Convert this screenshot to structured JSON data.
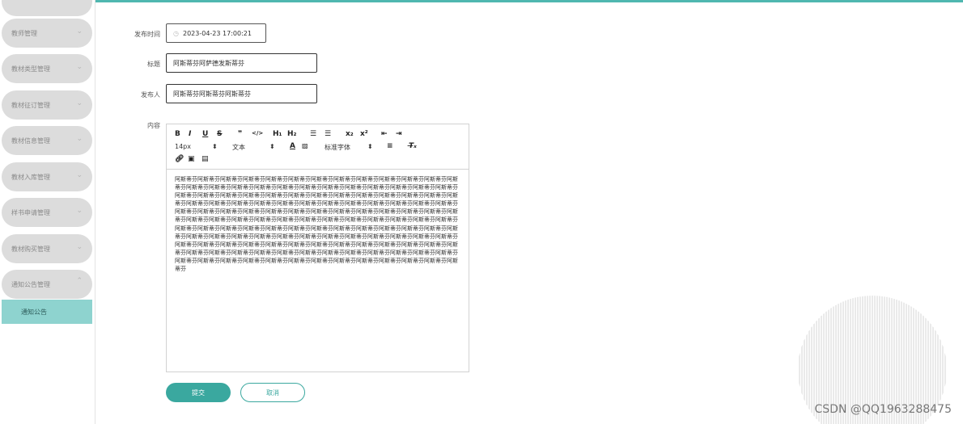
{
  "sidebar": {
    "items": [
      {
        "label": "教师管理"
      },
      {
        "label": "教材类型管理"
      },
      {
        "label": "教材征订管理"
      },
      {
        "label": "教材信息管理"
      },
      {
        "label": "教材入库管理"
      },
      {
        "label": "样书申请管理"
      },
      {
        "label": "教材购买管理"
      },
      {
        "label": "通知公告管理"
      }
    ],
    "active_sub": "通知公告"
  },
  "form": {
    "publish_time_label": "发布时间",
    "publish_time_value": "2023-04-23 17:00:21",
    "title_label": "标题",
    "title_value": "阿斯蒂芬阿萨德发斯蒂芬",
    "publisher_label": "发布人",
    "publisher_value": "阿斯蒂芬阿斯蒂芬阿斯蒂芬",
    "content_label": "内容"
  },
  "editor": {
    "font_size": "14px",
    "paragraph": "文本",
    "font_family": "标准字体",
    "content": "阿斯蒂芬阿斯蒂芬阿斯蒂芬阿斯蒂芬阿斯蒂芬阿斯蒂芬阿斯蒂芬阿斯蒂芬阿斯蒂芬阿斯蒂芬阿斯蒂芬阿斯蒂芬阿斯蒂芬阿斯蒂芬阿斯蒂芬阿斯蒂芬阿斯蒂芬阿斯蒂芬阿斯蒂芬阿斯蒂芬阿斯蒂芬阿斯蒂芬阿斯蒂芬阿斯蒂芬阿斯蒂芬阿斯蒂芬阿斯蒂芬阿斯蒂芬阿斯蒂芬阿斯蒂芬阿斯蒂芬阿斯蒂芬阿斯蒂芬阿斯蒂芬阿斯蒂芬阿斯蒂芬阿斯蒂芬阿斯蒂芬阿斯蒂芬阿斯蒂芬阿斯蒂芬阿斯蒂芬阿斯蒂芬阿斯蒂芬阿斯蒂芬阿斯蒂芬阿斯蒂芬阿斯蒂芬阿斯蒂芬阿斯蒂芬阿斯蒂芬阿斯蒂芬阿斯蒂芬阿斯蒂芬阿斯蒂芬阿斯蒂芬阿斯蒂芬阿斯蒂芬阿斯蒂芬阿斯蒂芬阿斯蒂芬阿斯蒂芬阿斯蒂芬阿斯蒂芬阿斯蒂芬阿斯蒂芬阿斯蒂芬阿斯蒂芬阿斯蒂芬阿斯蒂芬阿斯蒂芬阿斯蒂芬阿斯蒂芬阿斯蒂芬阿斯蒂芬阿斯蒂芬阿斯蒂芬阿斯蒂芬阿斯蒂芬阿斯蒂芬阿斯蒂芬阿斯蒂芬阿斯蒂芬阿斯蒂芬阿斯蒂芬阿斯蒂芬阿斯蒂芬阿斯蒂芬阿斯蒂芬阿斯蒂芬阿斯蒂芬阿斯蒂芬阿斯蒂芬阿斯蒂芬阿斯蒂芬阿斯蒂芬阿斯蒂芬阿斯蒂芬阿斯蒂芬阿斯蒂芬阿斯蒂芬阿斯蒂芬阿斯蒂芬阿斯蒂芬阿斯蒂芬阿斯蒂芬阿斯蒂芬阿斯蒂芬阿斯蒂芬阿斯蒂芬阿斯蒂芬阿斯蒂芬阿斯蒂芬阿斯蒂芬阿斯蒂芬阿斯蒂芬阿斯蒂芬阿斯蒂芬阿斯蒂芬阿斯蒂芬阿斯蒂芬阿斯蒂芬阿斯蒂芬阿斯蒂芬阿斯蒂芬阿斯蒂芬阿斯蒂芬阿斯蒂芬阿斯蒂芬阿斯蒂芬阿斯蒂芬阿斯蒂芬阿斯蒂芬阿斯蒂芬阿斯蒂芬阿斯蒂芬阿斯蒂芬阿斯蒂芬"
  },
  "actions": {
    "submit_label": "提交",
    "cancel_label": "取消"
  },
  "watermark": "CSDN @QQ1963288475",
  "colors": {
    "accent": "#3aa89f",
    "active_menu": "#8ed3cf",
    "menu_bg": "#dcdcdc"
  }
}
